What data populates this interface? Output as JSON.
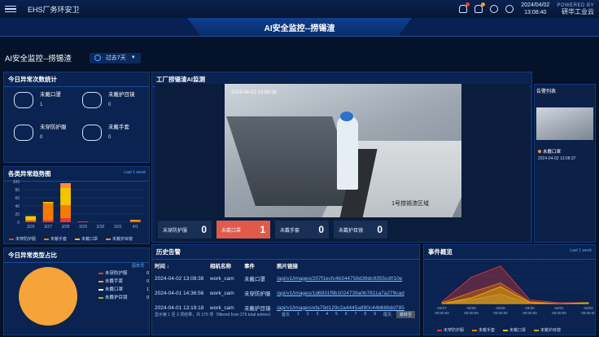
{
  "app": {
    "title": "EHS厂务环安卫",
    "date": "2024/04/02",
    "time": "13:08:40",
    "brand_top": "POWERED BY",
    "brand_name": "研华工业云",
    "header_title": "AI安全监控--捞锡渣"
  },
  "subbar": {
    "page_title": "AI安全监控--捞锡渣",
    "range": "过去7天"
  },
  "abnormal_count": {
    "title": "今日异常次数统计",
    "items": [
      {
        "label": "未戴口罩",
        "value": "1",
        "icon": "mask-icon"
      },
      {
        "label": "未戴护目镜",
        "value": "0",
        "icon": "goggles-icon"
      },
      {
        "label": "未穿防护服",
        "value": "0",
        "icon": "suit-icon"
      },
      {
        "label": "未戴手套",
        "value": "0",
        "icon": "glove-icon"
      }
    ]
  },
  "trend": {
    "title": "各类异常趋势图",
    "link": "Last 1 week",
    "legend": [
      "未穿防护服",
      "未戴手套",
      "未戴口罩",
      "未戴护目镜"
    ]
  },
  "type_share": {
    "title": "今日异常类型占比",
    "link": "图表项",
    "legend": [
      {
        "label": "未穿防护服",
        "value": "0",
        "color": "#e53935"
      },
      {
        "label": "未戴手套",
        "value": "0",
        "color": "#f5a623"
      },
      {
        "label": "未戴口罩",
        "value": "1",
        "color": "#ffffff"
      },
      {
        "label": "未戴护目镜",
        "value": "0",
        "color": "#c9a227"
      }
    ]
  },
  "monitor": {
    "title": "工厂捞锡渣AI监测",
    "timestamp": "2024-04-02 13:08:38",
    "camera": "1号捞锡渣区域",
    "stats": [
      {
        "label": "未穿防护服",
        "value": "0"
      },
      {
        "label": "未戴口罩",
        "value": "1"
      },
      {
        "label": "未戴手套",
        "value": "0"
      },
      {
        "label": "未戴护目镜",
        "value": "0"
      }
    ]
  },
  "alert_list": {
    "title": "告警列表",
    "item_label": "未戴口罩",
    "item_time": "2024-04-02 13:08:37"
  },
  "history": {
    "title": "历史告警",
    "headers": [
      "时间",
      "相机名称",
      "事件",
      "照片链接"
    ],
    "rows": [
      [
        "2024-04-02 13:08:38",
        "work_cam",
        "未戴口罩",
        "/api/v1/images/207f1ecfc4b344758d39dc9355cd010e"
      ],
      [
        "2024-04-01 14:36:56",
        "work_cam",
        "未穿防护服",
        "/api/v1/images/1d6931f9b1024739a0b7811a7a279cad"
      ],
      [
        "2024-04-01 13:19:18",
        "work_cam",
        "未戴护目镜",
        "/api/v1/images/efa79d129c2a4445a890c44b688dd785"
      ]
    ],
    "summary": "显示第 1 至 3 项结果，共 175 项（filtered from 275 total entries）",
    "prev": "首页",
    "pages": [
      "1",
      "2",
      "3",
      "4",
      "5",
      "6",
      "7",
      "8",
      "9"
    ],
    "next": "尾页",
    "go": "跳转至"
  },
  "events": {
    "title": "事件概览",
    "link": "Last 1 week",
    "legend": [
      "未穿防护服",
      "未戴手套",
      "未戴口罩",
      "未戴护目镜"
    ]
  },
  "chart_data": [
    {
      "type": "bar",
      "title": "各类异常趋势图",
      "categories": [
        "3/26",
        "3/27",
        "3/28",
        "3/29",
        "3/30",
        "3/31",
        "4/1"
      ],
      "ylim": [
        0,
        100
      ],
      "yticks": [
        0,
        20,
        40,
        60,
        80,
        100
      ],
      "stacked": true,
      "series": [
        {
          "name": "未穿防护服",
          "color": "#e53935",
          "values": [
            3,
            5,
            10,
            2,
            0,
            0,
            1
          ]
        },
        {
          "name": "未戴手套",
          "color": "#f57c00",
          "values": [
            2,
            42,
            32,
            0,
            0,
            0,
            4
          ]
        },
        {
          "name": "未戴口罩",
          "color": "#f5c400",
          "values": [
            10,
            3,
            42,
            0,
            0,
            0,
            1
          ]
        },
        {
          "name": "未戴护目镜",
          "color": "#ff8a3d",
          "values": [
            0,
            0,
            12,
            0,
            0,
            0,
            0
          ]
        }
      ],
      "legend_position": "bottom"
    },
    {
      "type": "pie",
      "title": "今日异常类型占比",
      "series": [
        {
          "name": "未穿防护服",
          "value": 0,
          "color": "#e53935"
        },
        {
          "name": "未戴手套",
          "value": 0,
          "color": "#f5a623"
        },
        {
          "name": "未戴口罩",
          "value": 1,
          "color": "#f6a33a"
        },
        {
          "name": "未戴护目镜",
          "value": 0,
          "color": "#c9a227"
        }
      ]
    },
    {
      "type": "area",
      "title": "事件概览",
      "x": [
        "03/27 00:00:00",
        "03/28 00:00:00",
        "03/29 00:00:00",
        "03/30 00:00:00",
        "04/01 00:00:00",
        "04/02 00:00:00"
      ],
      "series": [
        {
          "name": "未穿防护服",
          "color": "#e53935",
          "values": [
            2,
            28,
            40,
            4,
            1,
            1
          ]
        },
        {
          "name": "未戴手套",
          "color": "#f57c00",
          "values": [
            1,
            12,
            22,
            2,
            0,
            0
          ]
        },
        {
          "name": "未戴口罩",
          "color": "#f5c400",
          "values": [
            0,
            6,
            18,
            1,
            0,
            1
          ]
        },
        {
          "name": "未戴护目镜",
          "color": "#c9a227",
          "values": [
            0,
            4,
            10,
            0,
            0,
            0
          ]
        }
      ],
      "legend_position": "bottom"
    }
  ]
}
